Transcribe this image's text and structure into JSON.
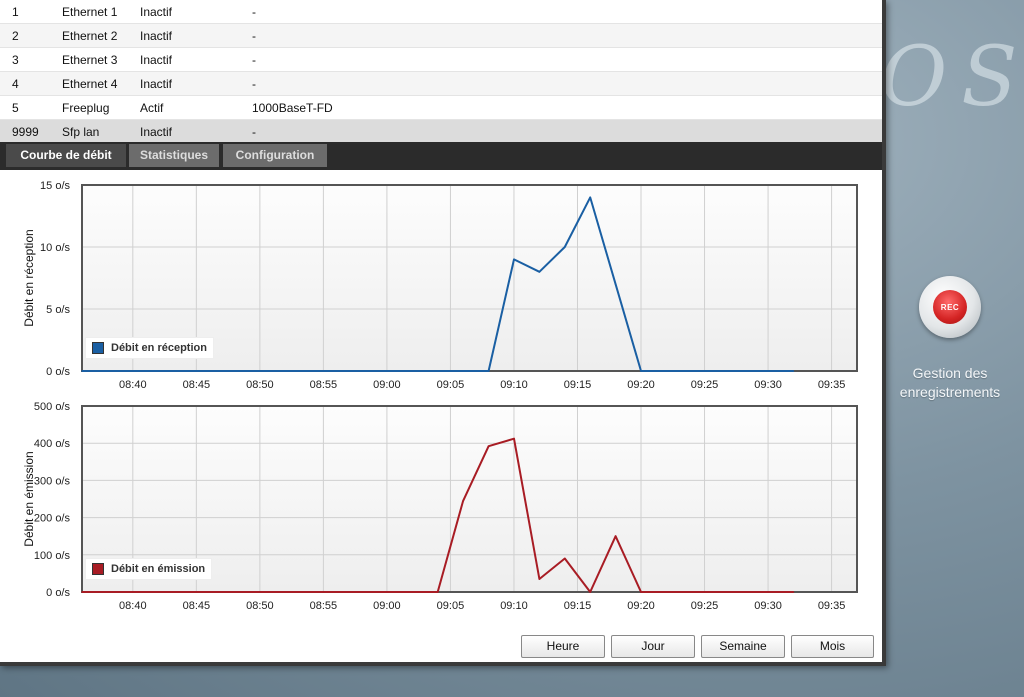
{
  "background": {
    "logo_text": "OS"
  },
  "rec": {
    "badge": "REC",
    "label_line1": "Gestion des",
    "label_line2": "enregistrements"
  },
  "ports": [
    {
      "id": "1",
      "name": "Ethernet 1",
      "state": "Inactif",
      "speed": "-"
    },
    {
      "id": "2",
      "name": "Ethernet 2",
      "state": "Inactif",
      "speed": "-"
    },
    {
      "id": "3",
      "name": "Ethernet 3",
      "state": "Inactif",
      "speed": "-"
    },
    {
      "id": "4",
      "name": "Ethernet 4",
      "state": "Inactif",
      "speed": "-"
    },
    {
      "id": "5",
      "name": "Freeplug",
      "state": "Actif",
      "speed": "1000BaseT-FD"
    },
    {
      "id": "9999",
      "name": "Sfp lan",
      "state": "Inactif",
      "speed": "-"
    }
  ],
  "tabs": [
    "Courbe de débit",
    "Statistiques",
    "Configuration"
  ],
  "buttons": {
    "hour": "Heure",
    "day": "Jour",
    "week": "Semaine",
    "month": "Mois"
  },
  "chart_data": [
    {
      "type": "line",
      "ylabel": "Débit en réception",
      "xticks": [
        "08:40",
        "08:45",
        "08:50",
        "08:55",
        "09:00",
        "09:05",
        "09:10",
        "09:15",
        "09:20",
        "09:25",
        "09:30",
        "09:35"
      ],
      "yticks": [
        "0 o/s",
        "5 o/s",
        "10 o/s",
        "15 o/s"
      ],
      "ylim": [
        0,
        15
      ],
      "color": "#1a5fa3",
      "legend": "Débit en réception",
      "legend_position": "bottom-left",
      "series": [
        {
          "name": "Débit en réception",
          "x": [
            "08:36",
            "09:08",
            "09:10",
            "09:12",
            "09:14",
            "09:16",
            "09:18",
            "09:20",
            "09:32"
          ],
          "values": [
            0,
            0,
            9,
            8,
            10,
            14,
            7,
            0,
            0
          ]
        }
      ]
    },
    {
      "type": "line",
      "ylabel": "Débit en émission",
      "xticks": [
        "08:40",
        "08:45",
        "08:50",
        "08:55",
        "09:00",
        "09:05",
        "09:10",
        "09:15",
        "09:20",
        "09:25",
        "09:30",
        "09:35"
      ],
      "yticks": [
        "0 o/s",
        "100 o/s",
        "200 o/s",
        "300 o/s",
        "400 o/s",
        "500 o/s"
      ],
      "ylim": [
        0,
        500
      ],
      "color": "#a81c24",
      "legend": "Débit en émission",
      "legend_position": "bottom-left",
      "series": [
        {
          "name": "Débit en émission",
          "x": [
            "08:36",
            "09:04",
            "09:06",
            "09:08",
            "09:10",
            "09:12",
            "09:14",
            "09:16",
            "09:18",
            "09:20",
            "09:32"
          ],
          "values": [
            0,
            0,
            245,
            392,
            412,
            35,
            90,
            0,
            150,
            0,
            0
          ]
        }
      ]
    }
  ]
}
